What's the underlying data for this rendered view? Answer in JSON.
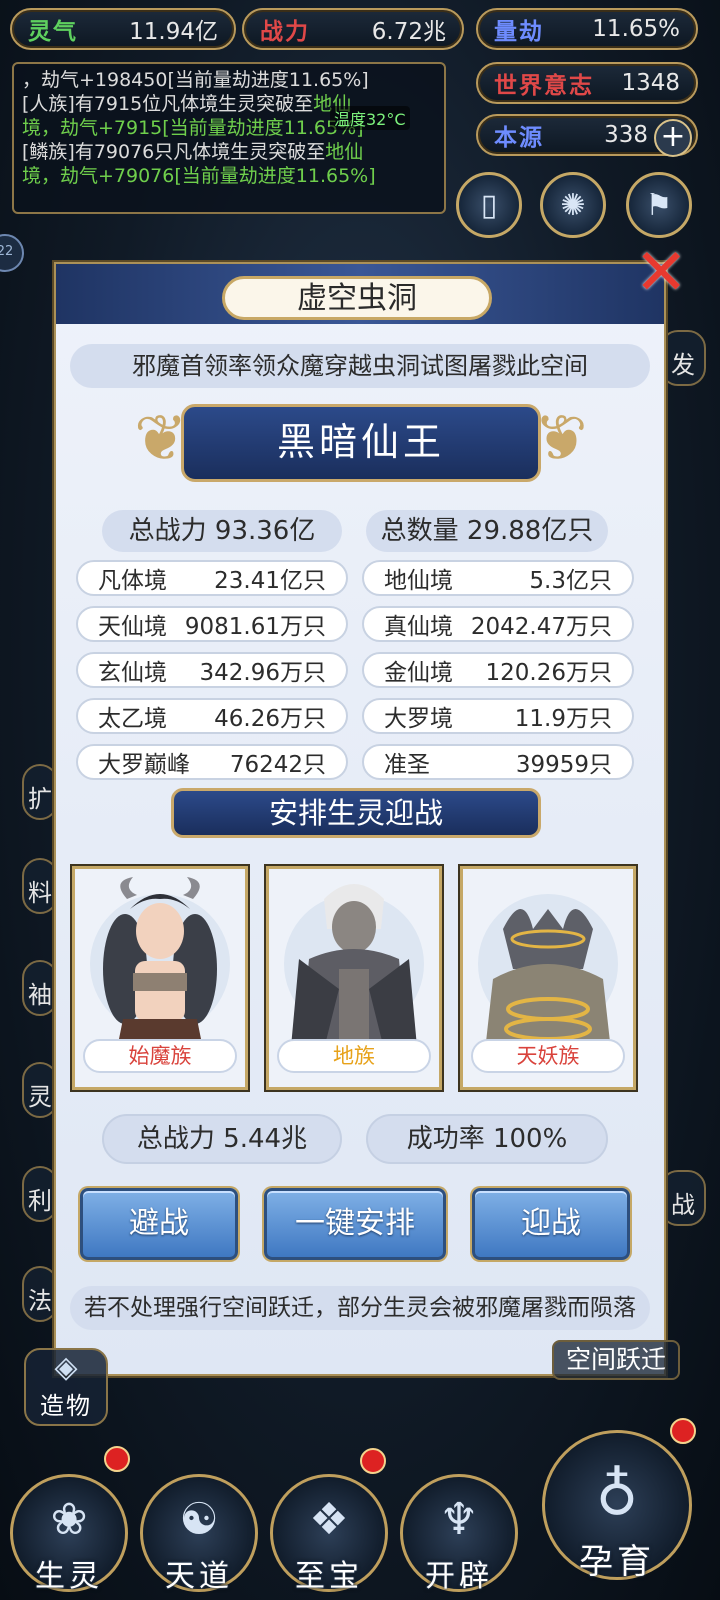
{
  "resources": {
    "lingqi": {
      "label": "灵气",
      "value": "11.94亿",
      "color": "#5fd15f"
    },
    "zhanli": {
      "label": "战力",
      "value": "6.72兆",
      "color": "#e04848"
    },
    "liangjie": {
      "label": "量劫",
      "value": "11.65%",
      "color": "#6e8cff"
    },
    "shijie": {
      "label": "世界意志",
      "value": "1348",
      "color": "#e04848"
    },
    "benyuan": {
      "label": "本源",
      "value": "338",
      "plus": "+",
      "color": "#6e8cff"
    }
  },
  "log": {
    "line1": "，劫气+198450[当前量劫进度11.65%]",
    "line2a": "[人族]有7915位凡体境生灵突破至",
    "line2b": "地仙",
    "line2c": "境，劫气+7915[当前量劫进度11.65%]",
    "line3a": "[鳞族]有79076只凡体境生灵突破至",
    "line3b": "地仙",
    "line3c": "境，劫气+79076[当前量劫进度11.65%]",
    "temperature": "温度32°C"
  },
  "side_left": [
    "22",
    "扩",
    "料",
    "袖",
    "灵",
    "利",
    "法"
  ],
  "side_right": [
    "发",
    "战"
  ],
  "modal": {
    "title": "虚空虫洞",
    "description": "邪魔首领率领众魔穿越虫洞试图屠戮此空间",
    "boss_name": "黑暗仙王",
    "total_power": "总战力 93.36亿",
    "total_count": "总数量 29.88亿只",
    "stats_left": [
      {
        "realm": "凡体境",
        "count": "23.41亿只"
      },
      {
        "realm": "天仙境",
        "count": "9081.61万只"
      },
      {
        "realm": "玄仙境",
        "count": "342.96万只"
      },
      {
        "realm": "太乙境",
        "count": "46.26万只"
      },
      {
        "realm": "大罗巅峰",
        "count": "76242只"
      }
    ],
    "stats_right": [
      {
        "realm": "地仙境",
        "count": "5.3亿只"
      },
      {
        "realm": "真仙境",
        "count": "2042.47万只"
      },
      {
        "realm": "金仙境",
        "count": "120.26万只"
      },
      {
        "realm": "大罗境",
        "count": "11.9万只"
      },
      {
        "realm": "准圣",
        "count": "39959只"
      }
    ],
    "arrange_title": "安排生灵迎战",
    "cards": [
      {
        "race": "始魔族",
        "color": "#d9433c"
      },
      {
        "race": "地族",
        "color": "#e7a21a"
      },
      {
        "race": "天妖族",
        "color": "#d9433c"
      }
    ],
    "our_power": "总战力 5.44兆",
    "success_rate": "成功率 100%",
    "buttons": {
      "avoid": "避战",
      "auto": "一键安排",
      "fight": "迎战"
    },
    "warning": "若不处理强行空间跃迁，部分生灵会被邪魔屠戮而陨落"
  },
  "jump_label": "空间跃迁",
  "create_label": "造物",
  "nav": [
    "生灵",
    "天道",
    "至宝",
    "开辟",
    "孕育"
  ]
}
